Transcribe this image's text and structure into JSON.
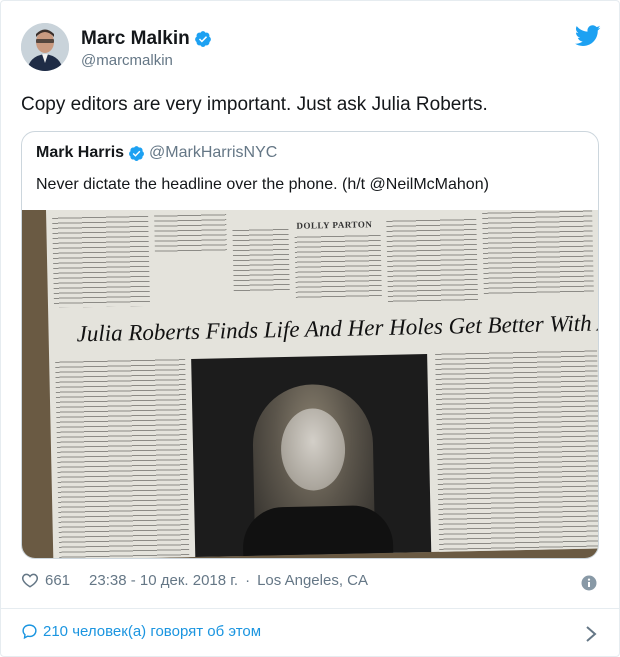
{
  "author": {
    "name": "Marc Malkin",
    "handle": "@marcmalkin",
    "avatar_icon": "avatar-photo",
    "verified_icon": "verified-badge-icon"
  },
  "tweet": {
    "text": "Copy editors are very important. Just ask Julia Roberts."
  },
  "quoted": {
    "name": "Mark Harris",
    "handle": "@MarkHarrisNYC",
    "text": "Never dictate the headline over the phone. (h/t @NeilMcMahon)",
    "photo": {
      "section_label": "DOLLY PARTON",
      "headline": "Julia Roberts Finds Life And Her Holes Get Better With Age"
    }
  },
  "meta": {
    "likes": "661",
    "time": "23:38 - 10 дек. 2018 г.",
    "location": "Los Angeles, CA"
  },
  "footer": {
    "talking_label": "210 человек(а) говорят об этом"
  },
  "colors": {
    "accent": "#1da1f2",
    "text": "#14171a",
    "secondary": "#657786",
    "link": "#1b95e0"
  }
}
